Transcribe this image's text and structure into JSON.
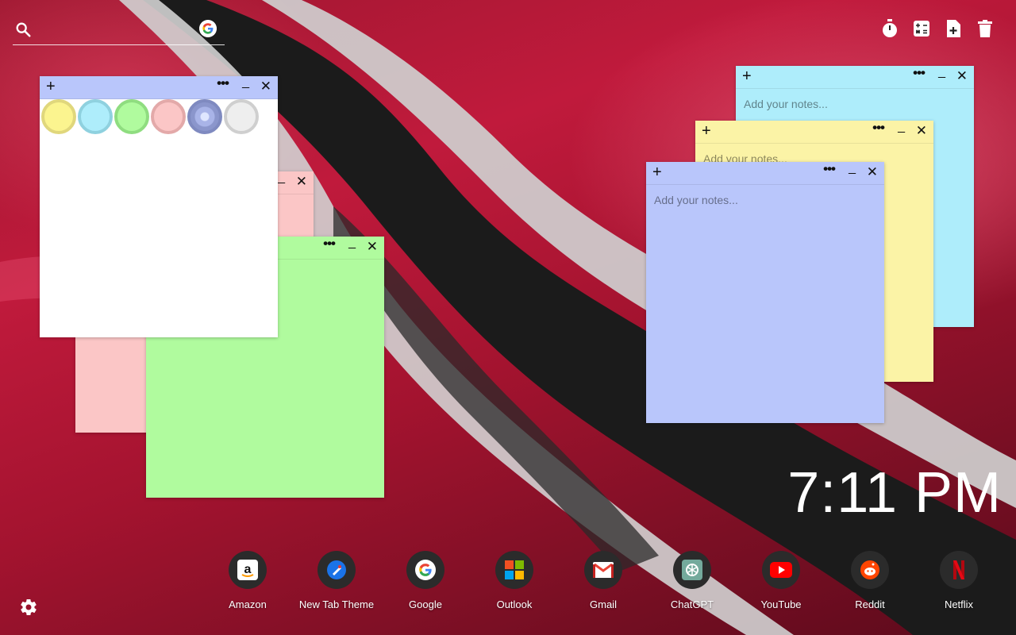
{
  "search": {
    "value": "",
    "placeholder": ""
  },
  "toolbar": [
    "timer-icon",
    "calculator-icon",
    "new-note-icon",
    "trash-icon"
  ],
  "swatch_colors": [
    "#fbf48f",
    "#aeedfb",
    "#b0fb9e",
    "#fbc6c6",
    "#a9b4e8",
    "#eeeeee"
  ],
  "notes": [
    {
      "color": "#aeedfb",
      "placeholder": "Add your notes..."
    },
    {
      "color": "#fbf3a6",
      "placeholder": "Add your notes..."
    },
    {
      "color": "#b9c6fb",
      "placeholder": "Add your notes..."
    },
    {
      "color": "#fbc6c6",
      "placeholder": ""
    },
    {
      "color": "#b0fb9e",
      "placeholder": ""
    },
    {
      "color": "#ffffff",
      "placeholder": ""
    }
  ],
  "note_buttons": {
    "add": "+",
    "more": "•••",
    "minimize": "_",
    "close": "✕"
  },
  "clock": "7:11 PM",
  "dock": [
    {
      "label": "Amazon",
      "icon": "amazon-icon"
    },
    {
      "label": "New Tab Theme",
      "icon": "new-tab-theme-icon"
    },
    {
      "label": "Google",
      "icon": "google-icon"
    },
    {
      "label": "Outlook",
      "icon": "outlook-icon"
    },
    {
      "label": "Gmail",
      "icon": "gmail-icon"
    },
    {
      "label": "ChatGPT",
      "icon": "chatgpt-icon"
    },
    {
      "label": "YouTube",
      "icon": "youtube-icon"
    },
    {
      "label": "Reddit",
      "icon": "reddit-icon"
    },
    {
      "label": "Netflix",
      "icon": "netflix-icon"
    }
  ],
  "colors": {
    "bg_red": "#b0173a",
    "stripe_black": "#1a1a1a",
    "stripe_white": "#d8d8d8"
  }
}
